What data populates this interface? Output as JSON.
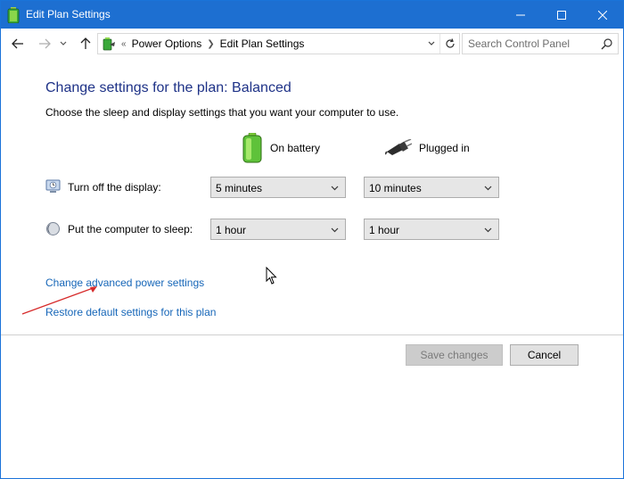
{
  "window": {
    "title": "Edit Plan Settings"
  },
  "address_bar": {
    "overflow": "«",
    "crumbs": [
      "Power Options",
      "Edit Plan Settings"
    ]
  },
  "search": {
    "placeholder": "Search Control Panel"
  },
  "main": {
    "heading": "Change settings for the plan: Balanced",
    "description": "Choose the sleep and display settings that you want your computer to use.",
    "columns": {
      "battery": "On battery",
      "plugged": "Plugged in"
    },
    "settings": [
      {
        "label": "Turn off the display:",
        "icon": "display-icon",
        "on_battery": "5 minutes",
        "plugged_in": "10 minutes"
      },
      {
        "label": "Put the computer to sleep:",
        "icon": "moon-icon",
        "on_battery": "1 hour",
        "plugged_in": "1 hour"
      }
    ],
    "links": {
      "advanced": "Change advanced power settings",
      "restore": "Restore default settings for this plan"
    }
  },
  "footer": {
    "save": "Save changes",
    "cancel": "Cancel"
  },
  "colors": {
    "titlebar": "#1d6fd1",
    "heading": "#1e3287",
    "link": "#1666b8",
    "annotation": "#d62a2a"
  }
}
